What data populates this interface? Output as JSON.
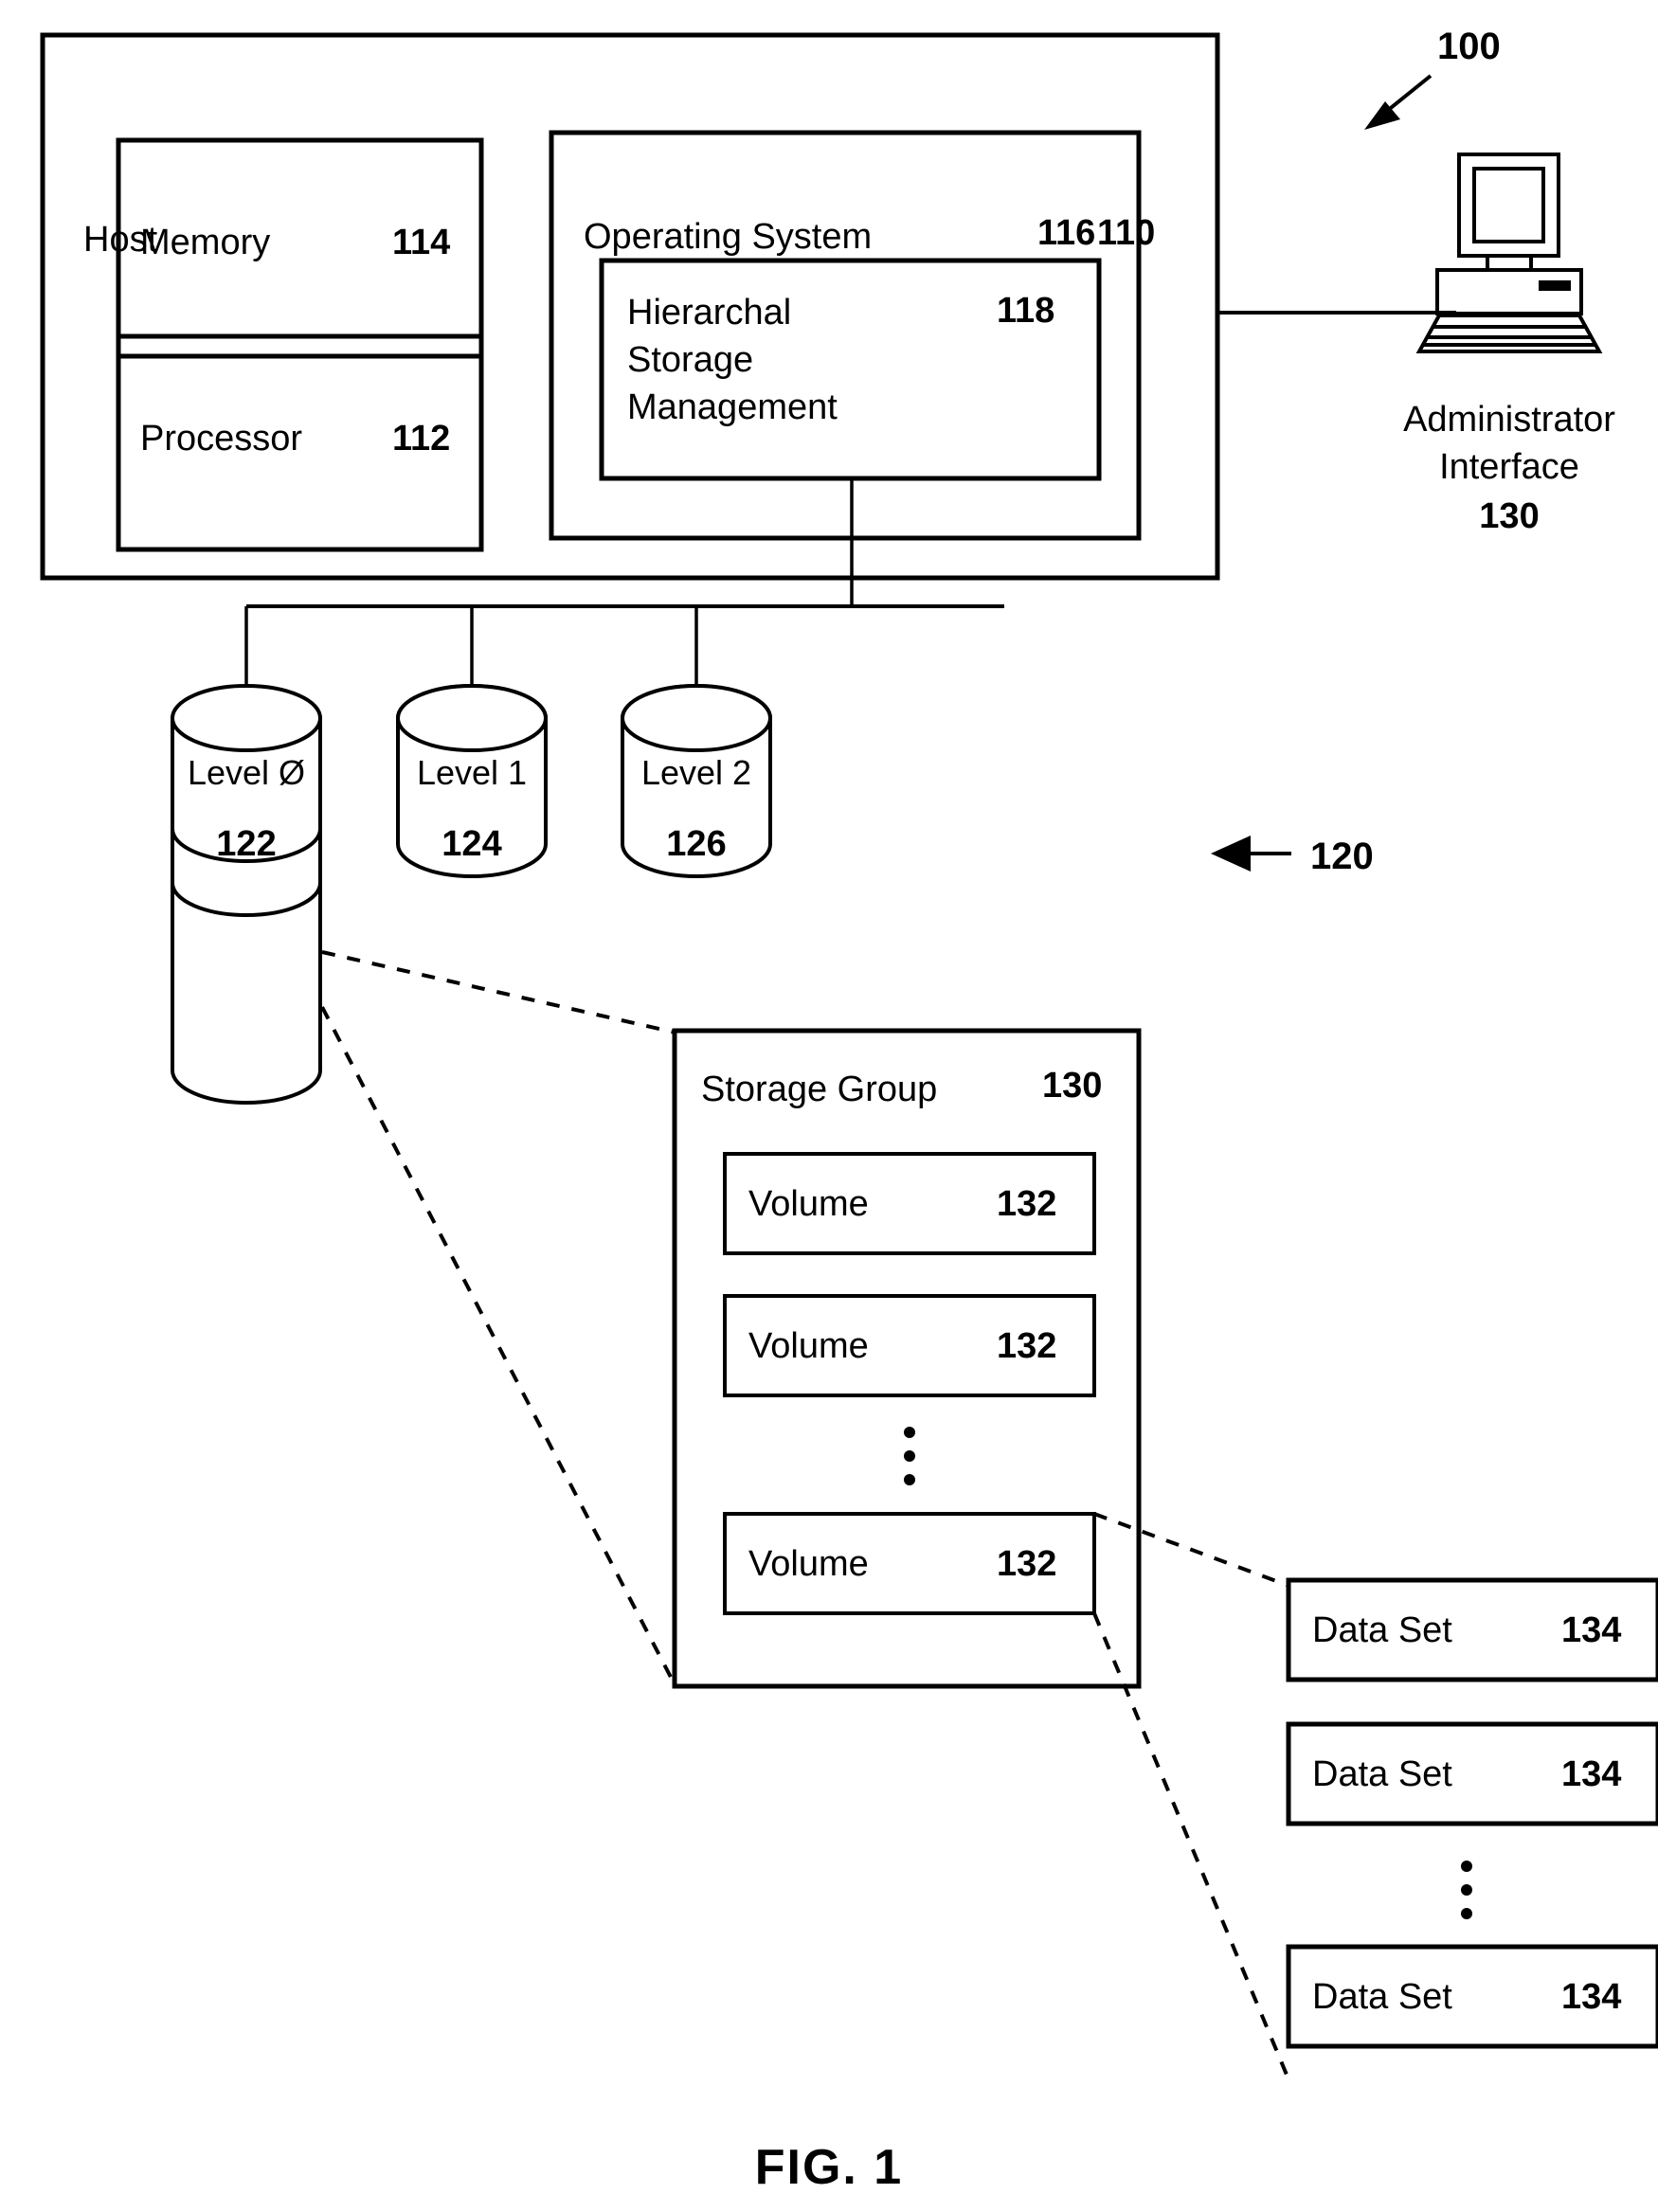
{
  "figure": {
    "caption": "FIG. 1",
    "system_ref": "100"
  },
  "host": {
    "title": "Host",
    "ref": "110",
    "memory": {
      "label": "Memory",
      "ref": "114"
    },
    "processor": {
      "label": "Processor",
      "ref": "112"
    },
    "operating_system": {
      "label": "Operating System",
      "ref": "116",
      "hsm": {
        "line1": "Hierarchal",
        "line2": "Storage",
        "line3": "Management",
        "ref": "118"
      }
    }
  },
  "administrator": {
    "line1": "Administrator",
    "line2": "Interface",
    "ref": "130",
    "icon": "desktop-computer-icon"
  },
  "storage_hierarchy": {
    "ref": "120",
    "levels": [
      {
        "label": "Level Ø",
        "ref": "122"
      },
      {
        "label": "Level 1",
        "ref": "124"
      },
      {
        "label": "Level 2",
        "ref": "126"
      }
    ]
  },
  "storage_group": {
    "title": "Storage Group",
    "ref": "130",
    "volumes": [
      {
        "label": "Volume",
        "ref": "132"
      },
      {
        "label": "Volume",
        "ref": "132"
      },
      {
        "label": "Volume",
        "ref": "132"
      }
    ],
    "ellipsis": "⋮"
  },
  "data_sets": {
    "items": [
      {
        "label": "Data Set",
        "ref": "134"
      },
      {
        "label": "Data Set",
        "ref": "134"
      },
      {
        "label": "Data Set",
        "ref": "134"
      }
    ],
    "ellipsis": "⋮"
  }
}
